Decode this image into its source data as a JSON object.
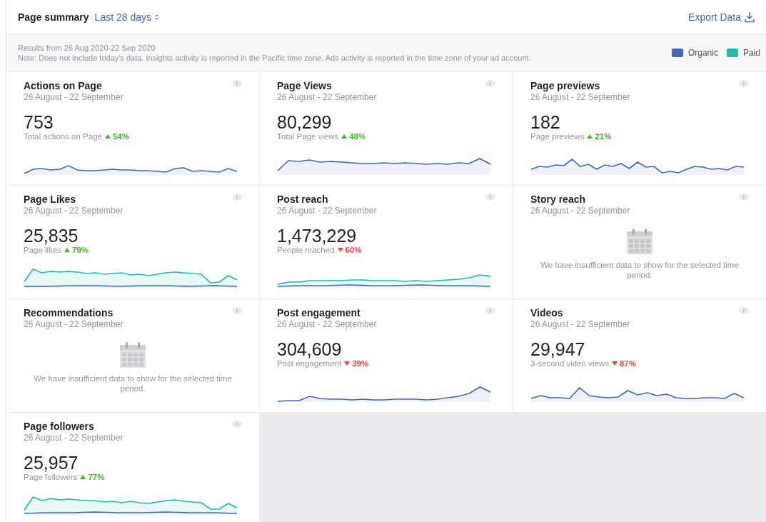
{
  "header": {
    "title": "Page summary",
    "range": "Last 28 days",
    "export": "Export Data"
  },
  "note": {
    "results_prefix": "Results from ",
    "results_range": "26 Aug 2020-22 Sep 2020",
    "text": "Note: Does not include today's data. Insights activity is reported in the Pacific time zone. Ads activity is reported in the time zone of your ad account."
  },
  "legend": [
    {
      "label": "Organic",
      "color": "#4267b2"
    },
    {
      "label": "Paid",
      "color": "#1fbba6"
    }
  ],
  "cards": [
    {
      "kind": "chart",
      "title": "Actions on Page",
      "date": "26 August - 22 September",
      "value": "753",
      "label": "Total actions on Page",
      "trend_up": true,
      "change": "54%",
      "paid": false
    },
    {
      "kind": "chart",
      "title": "Page Views",
      "date": "26 August - 22 September",
      "value": "80,299",
      "label": "Total Page views",
      "trend_up": true,
      "change": "48%",
      "paid": false
    },
    {
      "kind": "chart",
      "title": "Page previews",
      "date": "26 August - 22 September",
      "value": "182",
      "label": "Page previews",
      "trend_up": true,
      "change": "21%",
      "paid": false
    },
    {
      "kind": "chart",
      "title": "Page Likes",
      "date": "26 August - 22 September",
      "value": "25,835",
      "label": "Page likes",
      "trend_up": true,
      "change": "79%",
      "paid": true
    },
    {
      "kind": "chart",
      "title": "Post reach",
      "date": "26 August - 22 September",
      "value": "1,473,229",
      "label": "People reached",
      "trend_up": false,
      "change": "60%",
      "paid": true
    },
    {
      "kind": "empty",
      "title": "Story reach",
      "date": "26 August - 22 September",
      "message": "We have insufficient data to show for the selected time period."
    },
    {
      "kind": "empty",
      "title": "Recommendations",
      "date": "26 August - 22 September",
      "message": "We have insufficient data to show for the selected time period."
    },
    {
      "kind": "chart",
      "title": "Post engagement",
      "date": "26 August - 22 September",
      "value": "304,609",
      "label": "Post engagement",
      "trend_up": false,
      "change": "39%",
      "paid": false
    },
    {
      "kind": "chart",
      "title": "Videos",
      "date": "26 August - 22 September",
      "value": "29,947",
      "label": "3-second video views",
      "trend_up": false,
      "change": "87%",
      "paid": false
    },
    {
      "kind": "chart",
      "title": "Page followers",
      "date": "26 August - 22 September",
      "value": "25,957",
      "label": "Page followers",
      "trend_up": true,
      "change": "77%",
      "paid": true
    }
  ]
}
